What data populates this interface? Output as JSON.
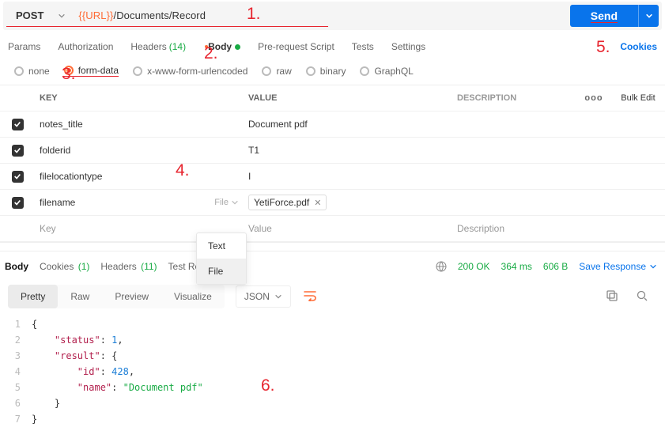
{
  "request": {
    "method": "POST",
    "url_var": "{{URL}}",
    "url_path": "/Documents/Record",
    "send_label": "Send"
  },
  "req_tabs": {
    "params": "Params",
    "auth": "Authorization",
    "headers": "Headers",
    "headers_count": "(14)",
    "body": "Body",
    "prereq": "Pre-request Script",
    "tests": "Tests",
    "settings": "Settings",
    "cookies": "Cookies"
  },
  "body_types": {
    "none": "none",
    "formdata": "form-data",
    "urlencoded": "x-www-form-urlencoded",
    "raw": "raw",
    "binary": "binary",
    "graphql": "GraphQL"
  },
  "grid": {
    "key_hdr": "KEY",
    "val_hdr": "VALUE",
    "desc_hdr": "DESCRIPTION",
    "more": "ooo",
    "bulk": "Bulk Edit",
    "key_ph": "Key",
    "val_ph": "Value",
    "desc_ph": "Description",
    "file_label": "File",
    "rows": [
      {
        "key": "notes_title",
        "value": "Document pdf"
      },
      {
        "key": "folderid",
        "value": "T1"
      },
      {
        "key": "filelocationtype",
        "value": "I"
      },
      {
        "key": "filename",
        "file": "YetiForce.pdf"
      }
    ]
  },
  "popup": {
    "text": "Text",
    "file": "File"
  },
  "resp_tabs": {
    "body": "Body",
    "cookies": "Cookies",
    "cookies_count": "(1)",
    "headers": "Headers",
    "headers_count": "(11)",
    "test": "Test Results"
  },
  "resp_meta": {
    "status": "200 OK",
    "time": "364 ms",
    "size": "606 B",
    "save": "Save Response"
  },
  "view": {
    "pretty": "Pretty",
    "raw": "Raw",
    "preview": "Preview",
    "visualize": "Visualize",
    "json": "JSON"
  },
  "json": {
    "l1": "{",
    "l2a": "    \"status\"",
    "l2b": ": ",
    "l2c": "1",
    "l2d": ",",
    "l3a": "    \"result\"",
    "l3b": ": {",
    "l4a": "        \"id\"",
    "l4b": ": ",
    "l4c": "428",
    "l4d": ",",
    "l5a": "        \"name\"",
    "l5b": ": ",
    "l5c": "\"Document pdf\"",
    "l6": "    }",
    "l7": "}"
  },
  "annot": {
    "a1": "1.",
    "a2": "2.",
    "a3": "3.",
    "a4": "4.",
    "a5": "5.",
    "a6": "6."
  }
}
